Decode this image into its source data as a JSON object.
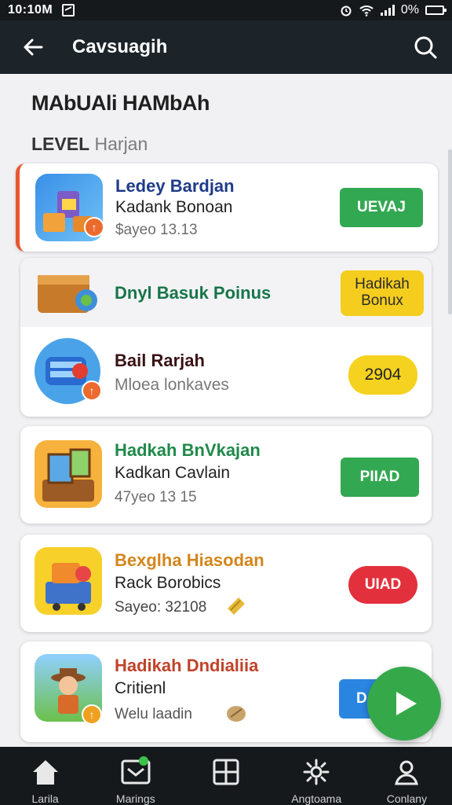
{
  "status_bar": {
    "time": "10:10M",
    "battery": "0%"
  },
  "app_bar": {
    "title": "Cavsuagih"
  },
  "page": {
    "heading": "MAbUAli HAMbAh",
    "level_label": "LEVEL",
    "level_value": "Harjan"
  },
  "cards": [
    {
      "title": "Ledey Bardjan",
      "subtitle": "Kadank Bonoan",
      "meta": "$ayeo 13.13",
      "action": "UEVAJ",
      "title_color": "#1f3c88"
    },
    {
      "title": "Dnyl Basuk Poinus",
      "action": "Hadikah Bonux",
      "title_color": "#17754a"
    },
    {
      "title": "Bail Rarjah",
      "subtitle": "Mloea lonkaves",
      "action": "2904",
      "title_color": "#3a1214"
    },
    {
      "title": "Hadkah BnVkajan",
      "subtitle": "Kadkan Cavlain",
      "meta": "47yeo 13 15",
      "action": "PIIAD",
      "title_color": "#1f8a4a"
    },
    {
      "title": "Bexglha Hiasodan",
      "subtitle": "Rack Borobics",
      "meta": "Sayeo: 32108",
      "action": "UIAD",
      "title_color": "#d4861c"
    },
    {
      "title": "Hadikah Dndialiia",
      "subtitle": "Critienl",
      "meta": "Welu laadin",
      "action": "D",
      "title_color": "#c0432a"
    }
  ],
  "bottom_nav": [
    {
      "label": "Larila",
      "icon": "home-icon"
    },
    {
      "label": "Marings",
      "icon": "messages-icon"
    },
    {
      "label": "",
      "icon": "grid-icon"
    },
    {
      "label": "Angtoama",
      "icon": "settings-icon"
    },
    {
      "label": "Conlany",
      "icon": "profile-icon"
    }
  ],
  "colors": {
    "accent_green": "#33a852",
    "highlight_border": "#e8572f",
    "bar_dark": "#1d2429"
  }
}
